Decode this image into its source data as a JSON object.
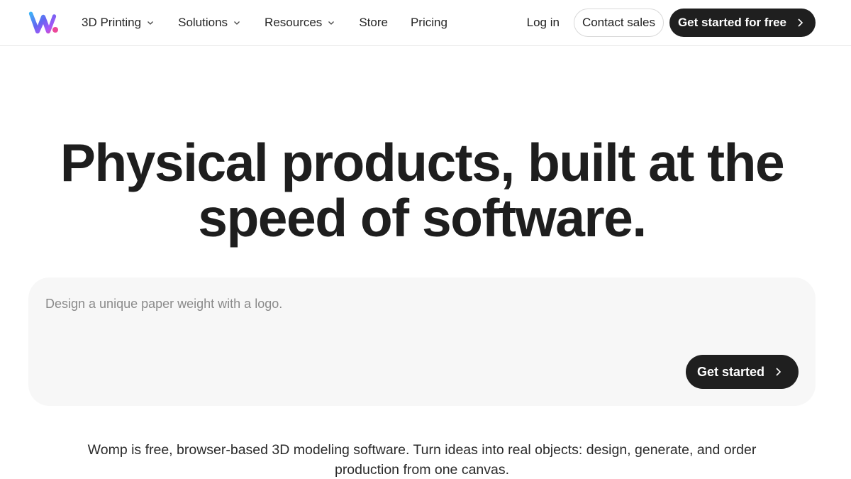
{
  "brand": {
    "logo_icon": "womp-w-logo-icon",
    "gradient": [
      "#3b82f6",
      "#8b5cf6",
      "#ec4899"
    ]
  },
  "nav": {
    "items": [
      {
        "label": "3D Printing",
        "has_dropdown": true
      },
      {
        "label": "Solutions",
        "has_dropdown": true
      },
      {
        "label": "Resources",
        "has_dropdown": true
      },
      {
        "label": "Store",
        "has_dropdown": false
      },
      {
        "label": "Pricing",
        "has_dropdown": false
      }
    ],
    "login_label": "Log in",
    "contact_label": "Contact sales",
    "cta_label": "Get started for free"
  },
  "hero": {
    "title_line1": "Physical products, built at the",
    "title_line2": "speed of software."
  },
  "prompt": {
    "placeholder": "Design a unique paper weight with a logo.",
    "button_label": "Get started"
  },
  "subtitle": {
    "line1": "Womp is free, browser-based 3D modeling software. Turn ideas into real objects: design, generate, and order",
    "line2": "production from one canvas."
  },
  "colors": {
    "dark": "#1f1f1f",
    "prompt_bg": "#f7f7f7",
    "border": "#e6e6e6"
  }
}
